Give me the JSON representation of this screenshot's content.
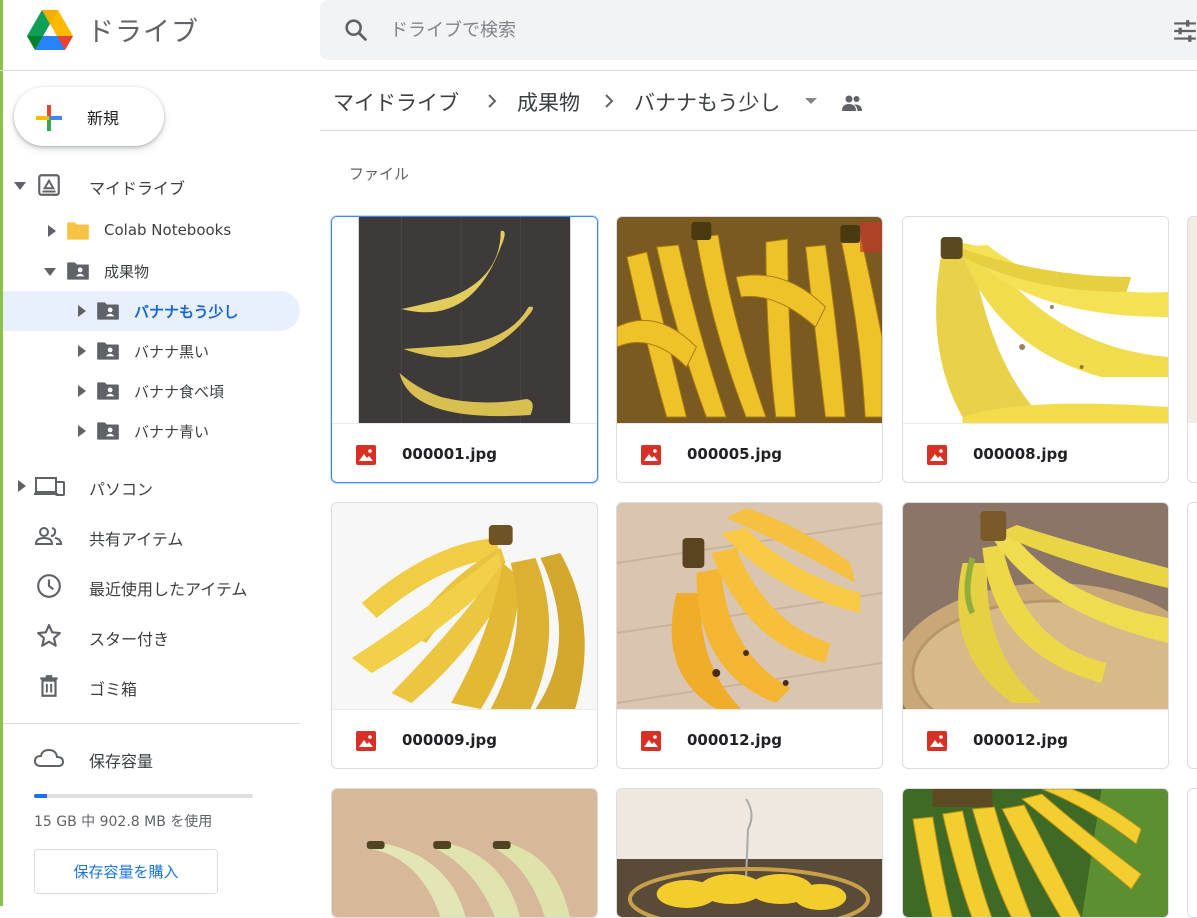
{
  "header": {
    "app_name": "ドライブ",
    "search_placeholder": "ドライブで検索"
  },
  "sidebar": {
    "new_label": "新規",
    "tree": {
      "my_drive": "マイドライブ",
      "colab": "Colab Notebooks",
      "deliverables": "成果物",
      "banana_almost": "バナナもう少し",
      "banana_black": "バナナ黒い",
      "banana_ripe": "バナナ食べ頃",
      "banana_green": "バナナ青い"
    },
    "nav": {
      "computers": "パソコン",
      "shared": "共有アイテム",
      "recent": "最近使用したアイテム",
      "starred": "スター付き",
      "trash": "ゴミ箱"
    },
    "storage": {
      "label": "保存容量",
      "usage_text": "15 GB 中 902.8 MB を使用",
      "used_fraction": 0.06,
      "buy_label": "保存容量を購入"
    }
  },
  "breadcrumb": {
    "root": "マイドライブ",
    "parent": "成果物",
    "current": "バナナもう少し"
  },
  "section_label": "ファイル",
  "files": [
    "000001.jpg",
    "000005.jpg",
    "000008.jpg",
    "000009.jpg",
    "000012.jpg",
    "000012.jpg"
  ],
  "colors": {
    "accent": "#1a73e8",
    "selected_bg": "#e8f0fe",
    "image_icon": "#d93025"
  },
  "icons": {
    "logo": "google-drive-logo",
    "search": "search-icon",
    "tune": "tune-icon",
    "file": "image-file-icon"
  }
}
